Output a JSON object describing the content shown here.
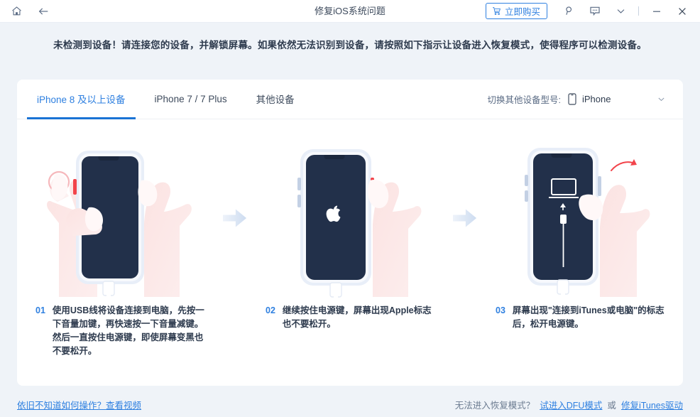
{
  "window": {
    "title": "修复iOS系统问题",
    "home_icon": "home-icon",
    "back_icon": "back-arrow-icon",
    "buy_label": "立即购买",
    "buy_icon": "shopping-cart-icon",
    "search_icon": "search-icon",
    "feedback_icon": "message-icon",
    "more_icon": "chevron-down-icon",
    "minimize_icon": "minimize-icon",
    "close_icon": "close-icon",
    "accent_color": "#2f80e0",
    "titlebar_bg": "#ffffff",
    "page_bg": "#eff3f8"
  },
  "banner": {
    "text": "未检测到设备！请连接您的设备，并解锁屏幕。如果依然无法识别到设备，请按照如下指示让设备进入恢复模式，使得程序可以检测设备。"
  },
  "tabs": [
    {
      "label": "iPhone 8 及以上设备",
      "active": true
    },
    {
      "label": "iPhone 7 / 7 Plus",
      "active": false
    },
    {
      "label": "其他设备",
      "active": false
    }
  ],
  "device_switch": {
    "label": "切换其他设备型号:",
    "icon": "phone-icon",
    "value": "iPhone",
    "chevron": "chevron-down-icon"
  },
  "steps": [
    {
      "num": "01",
      "text": "使用USB线将设备连接到电脑，先按一下音量加键，再快速按一下音量减键。然后一直按住电源键，即使屏幕变黑也不要松开。",
      "illustration": "iphone-two-hands-dark-screen"
    },
    {
      "num": "02",
      "text": "继续按住电源键，屏幕出现Apple标志也不要松开。",
      "illustration": "iphone-apple-logo-one-hand"
    },
    {
      "num": "03",
      "text": "屏幕出现\"连接到iTunes或电脑\"的标志后，松开电源键。",
      "illustration": "iphone-connect-to-itunes-release"
    }
  ],
  "footer": {
    "left_link": "依旧不知道如何操作？查看视频",
    "right_question": "无法进入恢复模式？",
    "right_link_1": "试进入DFU模式",
    "right_or": "或",
    "right_link_2": "修复iTunes驱动"
  }
}
